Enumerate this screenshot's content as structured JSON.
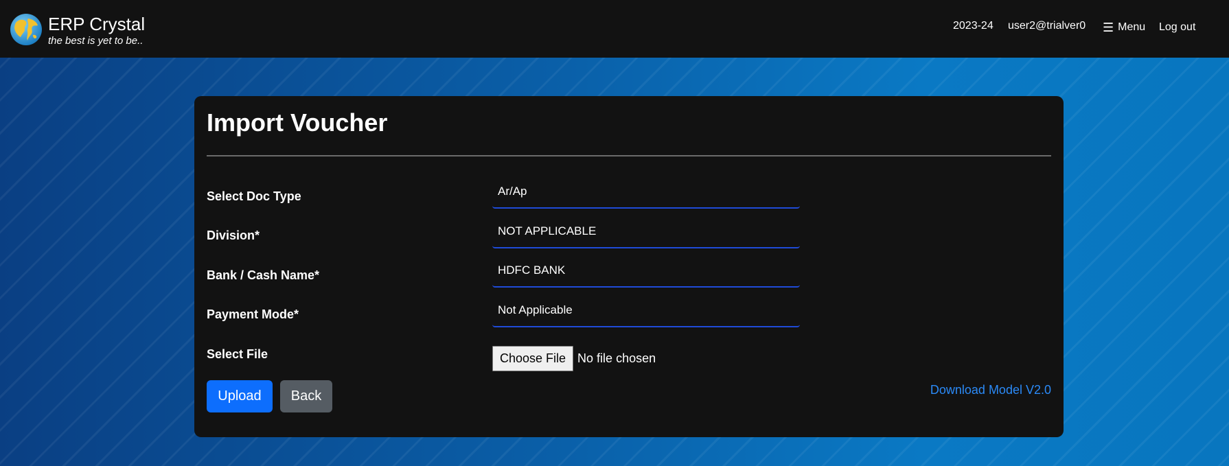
{
  "header": {
    "app_name": "ERP Crystal",
    "tagline": "the best is yet to be..",
    "logo_icon": "globe-icon",
    "financial_year": "2023-24",
    "user": "user2@trialver0",
    "menu_label": "Menu",
    "menu_icon": "hamburger-icon",
    "logout_label": "Log out"
  },
  "form": {
    "title": "Import Voucher",
    "fields": [
      {
        "label": "Select Doc Type",
        "value": "Ar/Ap"
      },
      {
        "label": "Division*",
        "value": "NOT APPLICABLE"
      },
      {
        "label": "Bank / Cash Name*",
        "value": "HDFC BANK"
      },
      {
        "label": "Payment Mode*",
        "value": "Not Applicable"
      }
    ],
    "file": {
      "label": "Select File",
      "button_label": "Choose File",
      "status": "No file chosen"
    },
    "upload_label": "Upload",
    "back_label": "Back",
    "download_label": "Download Model V2.0"
  },
  "colors": {
    "navbar_bg": "#121212",
    "card_bg": "#121212",
    "primary": "#0d6efd",
    "secondary": "#555c63",
    "link": "#2b8af7",
    "field_underline": "#1f4bd8"
  }
}
